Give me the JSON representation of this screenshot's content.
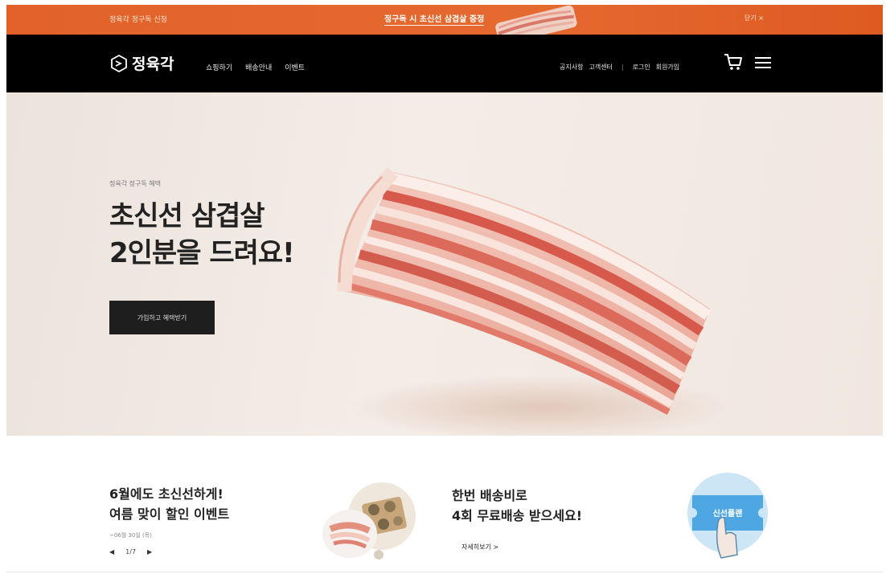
{
  "topbar": {
    "left_text": "정육각 정구독 신청",
    "center_text": "정구독 시 초신선 삼겹살 증정",
    "right_text": "닫기 ×"
  },
  "nav": {
    "logo_text": "정육각",
    "links": [
      "쇼핑하기",
      "배송안내",
      "이벤트"
    ],
    "util_links": [
      "공지사항",
      "고객센터",
      "로그인",
      "회원가입"
    ],
    "util_separator": "|"
  },
  "hero": {
    "eyebrow": "정육각 정구독 혜택",
    "title_line1": "초신선 삼겹살",
    "title_line2": "2인분을 드려요!",
    "cta_label": "가입하고 혜택받기"
  },
  "events": {
    "title_line1": "6월에도 초신선하게!",
    "title_line2": "여름 맞이 할인 이벤트",
    "date": "~06월 30일 (목)",
    "pager": {
      "prev": "◀",
      "current": "1",
      "total": "7",
      "divider": "/",
      "next": "▶"
    }
  },
  "delivery": {
    "title_line1": "한번 배송비로",
    "title_line2": "4회 무료배송 받으세요!",
    "link_label": "자세히보기 >",
    "ticket_label": "신선플랜"
  },
  "colors": {
    "promo_orange": "#e2622a",
    "nav_black": "#000000",
    "hero_beige": "#f2eae4",
    "cta_dark": "#1e1e1e"
  },
  "icons": [
    "logo-mark-icon",
    "cart-icon",
    "menu-icon",
    "prev-arrow-icon",
    "next-arrow-icon",
    "ticket-icon"
  ]
}
